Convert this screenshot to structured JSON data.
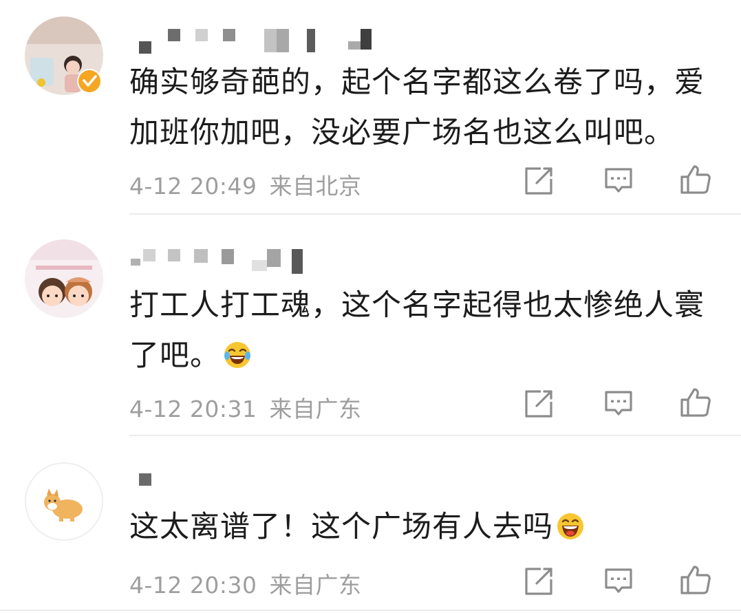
{
  "comments": [
    {
      "text": "确实够奇葩的，起个名字都这么卷了吗，爱加班你加吧，没必要广场名也这么叫吧。",
      "date": "4-12 20:49",
      "location": "来自北京",
      "verified": true,
      "emoji": ""
    },
    {
      "text": "打工人打工魂，这个名字起得也太惨绝人寰了吧。",
      "date": "4-12 20:31",
      "location": "来自广东",
      "verified": false,
      "emoji": "laughing-tears-emoji"
    },
    {
      "text": "这太离谱了！这个广场有人去吗",
      "date": "4-12 20:30",
      "location": "来自广东",
      "verified": false,
      "emoji": "grinning-emoji"
    }
  ],
  "icons": {
    "share": "share-icon",
    "comment": "comment-icon",
    "like": "like-icon"
  },
  "colors": {
    "text": "#1c1c1c",
    "meta": "#9e9e9e",
    "icon": "#8c8c8c",
    "verified_badge": "#f5a623",
    "divider": "#ececec"
  }
}
